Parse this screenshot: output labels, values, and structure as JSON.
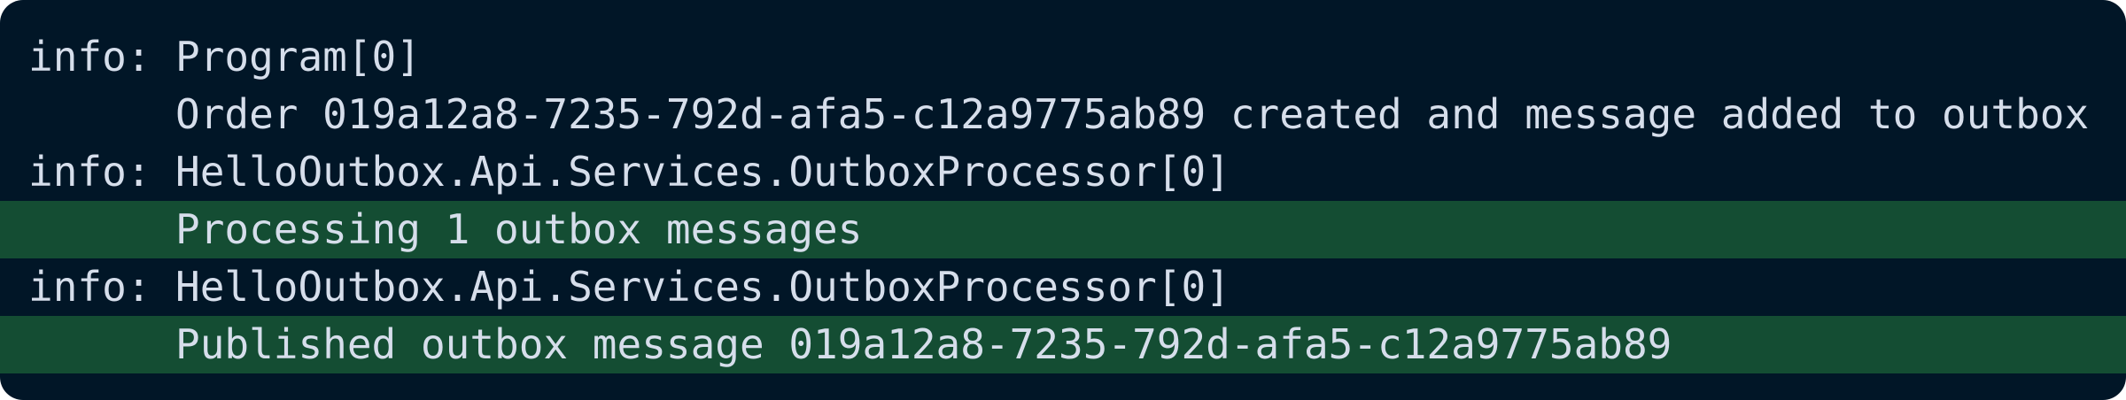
{
  "terminal": {
    "colors": {
      "background": "#011627",
      "highlight": "#144d33",
      "text": "#d6deeb"
    },
    "lines": [
      {
        "level": "info:",
        "text": "Program[0]",
        "highlight": false
      },
      {
        "level": "",
        "text": "Order 019a12a8-7235-792d-afa5-c12a9775ab89 created and message added to outbox",
        "highlight": false
      },
      {
        "level": "info:",
        "text": "HelloOutbox.Api.Services.OutboxProcessor[0]",
        "highlight": false
      },
      {
        "level": "",
        "text": "Processing 1 outbox messages",
        "highlight": true
      },
      {
        "level": "info:",
        "text": "HelloOutbox.Api.Services.OutboxProcessor[0]",
        "highlight": false
      },
      {
        "level": "",
        "text": "Published outbox message 019a12a8-7235-792d-afa5-c12a9775ab89",
        "highlight": true
      }
    ]
  }
}
